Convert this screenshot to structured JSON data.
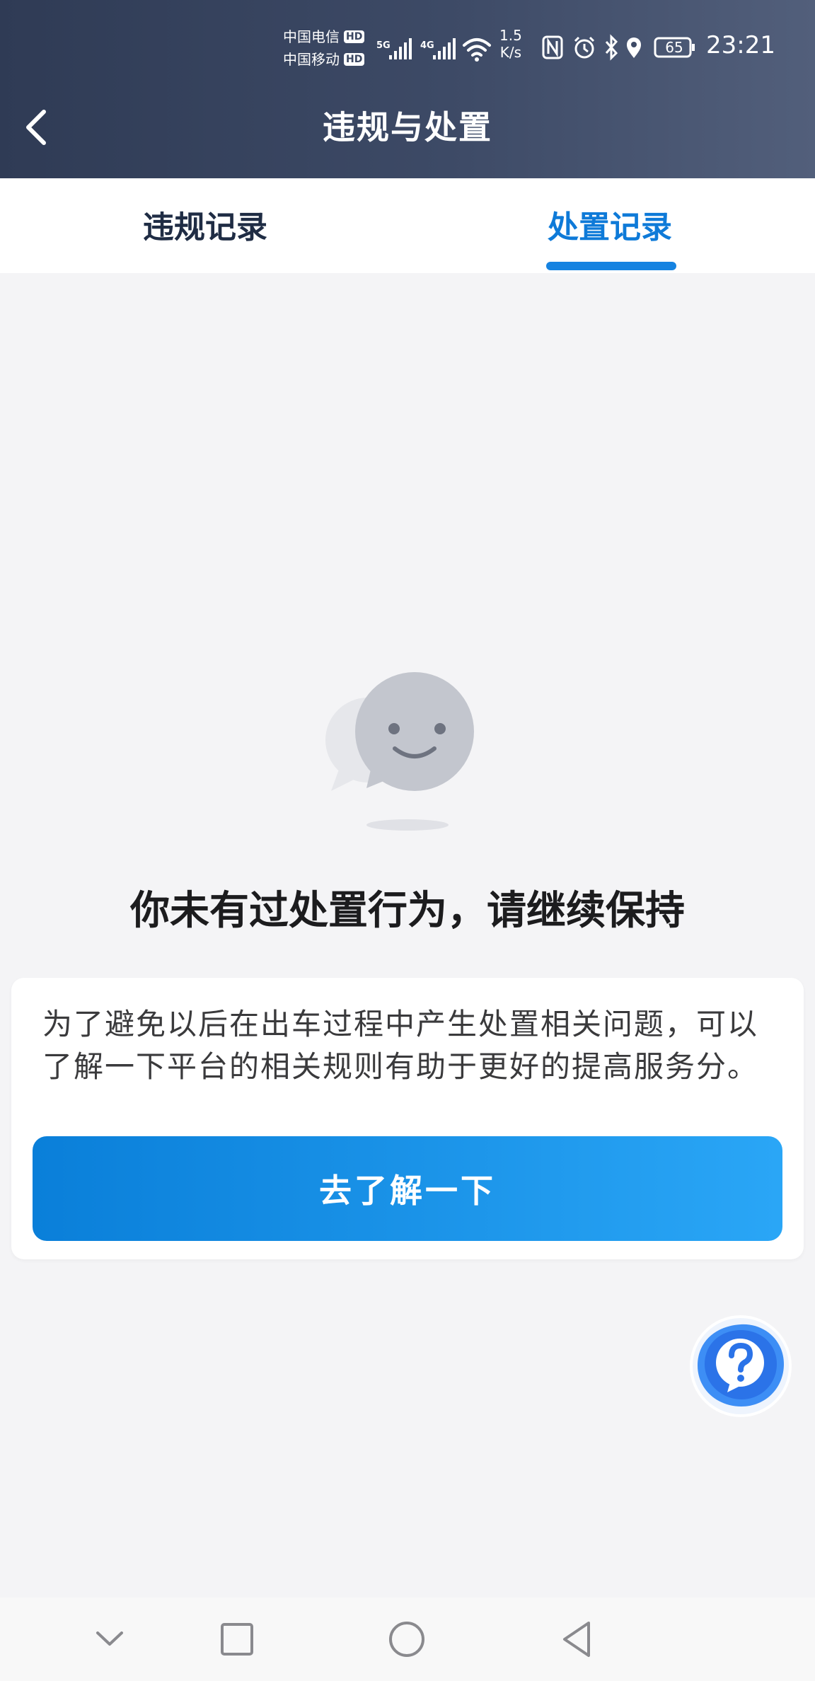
{
  "status_bar": {
    "carrier_1": "中国电信",
    "carrier_2": "中国移动",
    "hd_label": "HD",
    "net_5g": "5G",
    "net_4g": "4G",
    "speed_value": "1.5",
    "speed_unit": "K/s",
    "battery": "65",
    "time": "23:21"
  },
  "header": {
    "title": "违规与处置"
  },
  "tabs": [
    {
      "label": "违规记录",
      "active": false
    },
    {
      "label": "处置记录",
      "active": true
    }
  ],
  "empty_state": {
    "title": "你未有过处置行为，请继续保持"
  },
  "info_card": {
    "text": "为了避免以后在出车过程中产生处置相关问题，可以了解一下平台的相关规则有助于更好的提高服务分。",
    "button_label": "去了解一下"
  },
  "colors": {
    "header_bg": "#3d4a66",
    "accent": "#1683e1",
    "button_start": "#0a7fd9",
    "button_end": "#2aa6f6"
  }
}
